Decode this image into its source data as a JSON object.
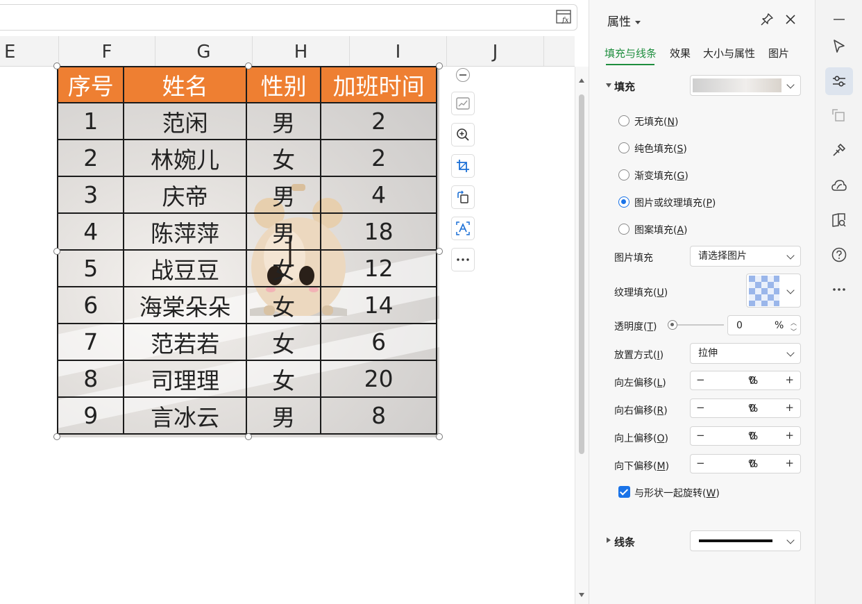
{
  "formula_bar": {
    "fx_label": "fx"
  },
  "columns": [
    "E",
    "F",
    "G",
    "H",
    "I",
    "J"
  ],
  "table": {
    "headers": [
      "序号",
      "姓名",
      "性别",
      "加班时间"
    ],
    "rows": [
      [
        "1",
        "范闲",
        "男",
        "2"
      ],
      [
        "2",
        "林婉儿",
        "女",
        "2"
      ],
      [
        "3",
        "庆帝",
        "男",
        "4"
      ],
      [
        "4",
        "陈萍萍",
        "男",
        "18"
      ],
      [
        "5",
        "战豆豆",
        "女",
        "12"
      ],
      [
        "6",
        "海棠朵朵",
        "女",
        "14"
      ],
      [
        "7",
        "范若若",
        "女",
        "6"
      ],
      [
        "8",
        "司理理",
        "女",
        "20"
      ],
      [
        "9",
        "言冰云",
        "男",
        "8"
      ]
    ],
    "header_color": "#ee7f32"
  },
  "float_toolbar": {
    "icons": [
      "collapse-icon",
      "chart-icon",
      "zoom-in-icon",
      "crop-icon",
      "rotate-icon",
      "text-style-icon",
      "more-icon"
    ]
  },
  "panel": {
    "title": "属性",
    "tabs": [
      "填充与线条",
      "效果",
      "大小与属性",
      "图片"
    ],
    "fill": {
      "title": "填充",
      "options": [
        {
          "text": "无填充(",
          "key": "N"
        },
        {
          "text": "纯色填充(",
          "key": "S"
        },
        {
          "text": "渐变填充(",
          "key": "G"
        },
        {
          "text": "图片或纹理填充(",
          "key": "P"
        },
        {
          "text": "图案填充(",
          "key": "A"
        }
      ],
      "selected_index": 3,
      "picture_fill_label": "图片填充",
      "picture_fill_value": "请选择图片",
      "texture_fill_label": "纹理填充(",
      "texture_fill_key": "U",
      "transparency_label": "透明度(",
      "transparency_key": "T",
      "transparency_value": "0",
      "percent": "%",
      "placement_label": "放置方式(",
      "placement_key": "I",
      "placement_value": "拉伸",
      "offsets": [
        {
          "label": "向左偏移(",
          "key": "L",
          "value": "0"
        },
        {
          "label": "向右偏移(",
          "key": "R",
          "value": "0"
        },
        {
          "label": "向上偏移(",
          "key": "O",
          "value": "0"
        },
        {
          "label": "向下偏移(",
          "key": "M",
          "value": "0"
        }
      ],
      "rotate_with_shape_label": "与形状一起旋转(",
      "rotate_with_shape_key": "W",
      "rotate_with_shape_checked": true
    },
    "line": {
      "title": "线条"
    },
    "accent_color": "#1e8e3e"
  },
  "right_toolbar": {
    "icons": [
      "minimize-icon",
      "select-cursor-icon",
      "properties-icon",
      "transform-icon",
      "style-brush-icon",
      "cloud-icon",
      "smart-book-icon",
      "help-icon",
      "more-icon"
    ]
  }
}
